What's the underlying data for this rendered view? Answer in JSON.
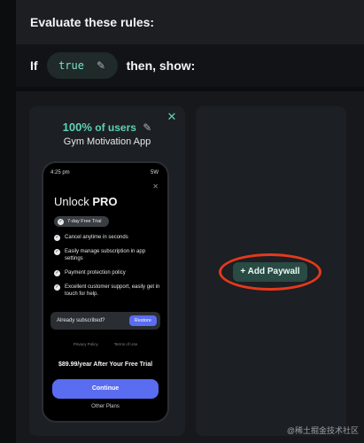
{
  "header": {
    "title": "Evaluate these rules:"
  },
  "rule": {
    "if_label": "If",
    "condition_value": "true",
    "then_label": "then, show:"
  },
  "variant": {
    "percent": "100%",
    "percent_suffix": "of users",
    "app_name": "Gym Motivation App"
  },
  "phone": {
    "time": "4:25 pm",
    "signal": "5W",
    "title_light": "Unlock",
    "title_bold": "PRO",
    "trial_badge": "7-day Free Trial",
    "features": [
      "Cancel anytime in seconds",
      "Easily manage subscription in app settings",
      "Payment protection policy",
      "Excellent customer support, easily get in touch for help."
    ],
    "already_subscribed": "Already subscribed?",
    "restore": "Restore",
    "privacy": "Privacy Policy",
    "terms": "Terms of Use",
    "price": "$89.99/year After Your Free Trial",
    "continue": "Continue",
    "other_plans": "Other Plans"
  },
  "add_paywall": "+ Add Paywall",
  "watermark": "@稀土掘金技术社区",
  "colors": {
    "accent": "#5ed1b8",
    "button": "#5a6cf0",
    "highlight": "#e4391c"
  }
}
